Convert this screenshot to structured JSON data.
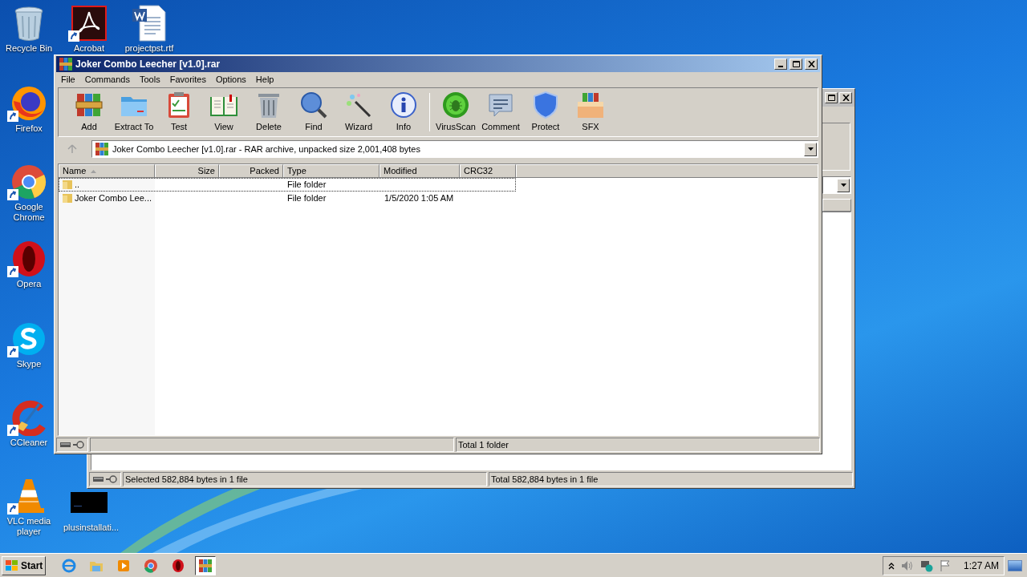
{
  "desktop_icons": [
    {
      "label": "Recycle Bin",
      "kind": "recycle",
      "shortcut": false
    },
    {
      "label": "Acrobat",
      "kind": "acrobat",
      "shortcut": true
    },
    {
      "label": "projectpst.rtf",
      "kind": "word",
      "shortcut": false
    },
    {
      "label": "Firefox",
      "kind": "firefox",
      "shortcut": true
    },
    {
      "label": "Google Chrome",
      "kind": "chrome",
      "shortcut": true
    },
    {
      "label": "Opera",
      "kind": "opera",
      "shortcut": true
    },
    {
      "label": "Skype",
      "kind": "skype",
      "shortcut": true
    },
    {
      "label": "CCleaner",
      "kind": "ccleaner",
      "shortcut": true
    },
    {
      "label": "VLC media player",
      "kind": "vlc",
      "shortcut": true
    },
    {
      "label": "plusinstallati...",
      "kind": "console",
      "shortcut": false
    }
  ],
  "back_window": {
    "status_left": "Selected 582,884 bytes in 1 file",
    "status_right": "Total 582,884 bytes in 1 file"
  },
  "window": {
    "title": "Joker Combo Leecher [v1.0].rar",
    "menu": [
      "File",
      "Commands",
      "Tools",
      "Favorites",
      "Options",
      "Help"
    ],
    "toolbar": [
      {
        "label": "Add",
        "kind": "add"
      },
      {
        "label": "Extract To",
        "kind": "extract"
      },
      {
        "label": "Test",
        "kind": "test"
      },
      {
        "label": "View",
        "kind": "view"
      },
      {
        "label": "Delete",
        "kind": "delete"
      },
      {
        "label": "Find",
        "kind": "find"
      },
      {
        "label": "Wizard",
        "kind": "wizard"
      },
      {
        "label": "Info",
        "kind": "info"
      },
      {
        "label": "VirusScan",
        "kind": "virus"
      },
      {
        "label": "Comment",
        "kind": "comment"
      },
      {
        "label": "Protect",
        "kind": "protect"
      },
      {
        "label": "SFX",
        "kind": "sfx"
      }
    ],
    "address": "Joker Combo Leecher [v1.0].rar - RAR archive, unpacked size 2,001,408 bytes",
    "columns": [
      {
        "label": "Name",
        "sorted": true
      },
      {
        "label": "Size",
        "sorted": false
      },
      {
        "label": "Packed",
        "sorted": false
      },
      {
        "label": "Type",
        "sorted": false
      },
      {
        "label": "Modified",
        "sorted": false
      },
      {
        "label": "CRC32",
        "sorted": false
      }
    ],
    "rows": [
      {
        "name": "..",
        "type": "File folder",
        "focused": true
      },
      {
        "name": "Joker Combo Lee...",
        "type": "File folder",
        "modified": "1/5/2020 1:05 AM",
        "focused": false
      }
    ],
    "status_text": "Total 1 folder"
  },
  "taskbar": {
    "start": "Start",
    "apps": [
      {
        "kind": "ie",
        "active": false
      },
      {
        "kind": "explorer",
        "active": false
      },
      {
        "kind": "media",
        "active": false
      },
      {
        "kind": "chrome",
        "active": false
      },
      {
        "kind": "opera",
        "active": false
      },
      {
        "kind": "winrar",
        "active": true
      }
    ],
    "clock": "1:27 AM"
  }
}
